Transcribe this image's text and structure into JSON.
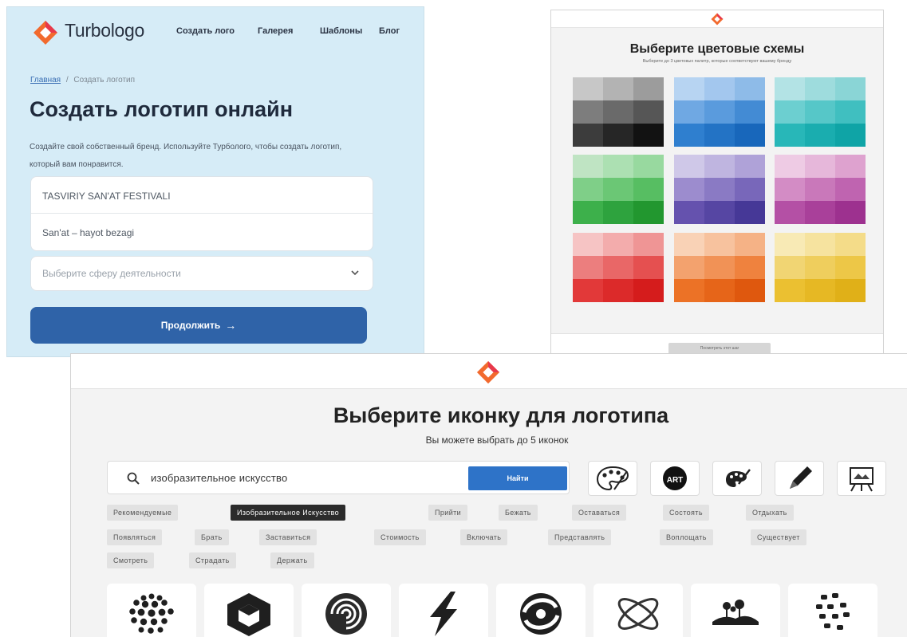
{
  "create_panel": {
    "brand": "Turbologo",
    "nav": [
      "Создать лого",
      "Галерея",
      "Шаблоны",
      "Блог"
    ],
    "breadcrumb": {
      "home": "Главная",
      "separator": "/",
      "current": "Создать логотип"
    },
    "heading": "Создать логотип онлайн",
    "description": "Создайте свой собственный бренд. Используйте Турболого, чтобы создать логотип, который вам понравится.",
    "company_name_value": "TASVIRIY SAN'AT FESTIVALI",
    "slogan_value": "San'at – hayot bezagi",
    "industry_placeholder": "Выберите сферу деятельности",
    "continue_label": "Продолжить",
    "continue_arrow": "→"
  },
  "colors_panel": {
    "title": "Выберите цветовые схемы",
    "subtitle": "Выберите до 3 цветовых палитр, которые соответствуют вашему бренду",
    "palettes": [
      {
        "name": "grey",
        "colors": [
          "#c7c7c7",
          "#b3b3b3",
          "#9c9c9c",
          "#7d7d7d",
          "#6a6a6a",
          "#565656",
          "#3c3c3c",
          "#262626",
          "#121212"
        ]
      },
      {
        "name": "blue",
        "colors": [
          "#b7d4f2",
          "#a3c7ee",
          "#8ebbe8",
          "#6fa8e3",
          "#5a9bdd",
          "#438bd4",
          "#2f7fcf",
          "#2373c5",
          "#1867bb"
        ]
      },
      {
        "name": "teal",
        "colors": [
          "#b3e3e5",
          "#9edcdd",
          "#8ad5d6",
          "#6ccfd0",
          "#56c7c8",
          "#40bfc0",
          "#28b7b8",
          "#1aadaf",
          "#0fa4a6"
        ]
      },
      {
        "name": "green",
        "colors": [
          "#bfe4c3",
          "#ace0b2",
          "#98d99f",
          "#7fcf88",
          "#6bc775",
          "#57be62",
          "#3db04b",
          "#2ea33e",
          "#22972f"
        ]
      },
      {
        "name": "purple",
        "colors": [
          "#cfc8e8",
          "#bfb5e0",
          "#afa2d8",
          "#9c8cce",
          "#8a7ac4",
          "#7867ba",
          "#6552ae",
          "#5646a3",
          "#463897"
        ]
      },
      {
        "name": "pink",
        "colors": [
          "#eecbe4",
          "#e6b7da",
          "#dea2cf",
          "#d38cc5",
          "#c978ba",
          "#bf64b0",
          "#b450a5",
          "#a9409a",
          "#9d318f"
        ]
      },
      {
        "name": "red",
        "colors": [
          "#f6c4c4",
          "#f3acac",
          "#ef9595",
          "#ec7e7e",
          "#e96767",
          "#e55050",
          "#e23939",
          "#dc2a2a",
          "#d51c1c"
        ]
      },
      {
        "name": "orange",
        "colors": [
          "#f9d2b6",
          "#f7c29e",
          "#f5b286",
          "#f3a26e",
          "#f19256",
          "#ef823e",
          "#ec7226",
          "#e66519",
          "#df580e"
        ]
      },
      {
        "name": "yellow",
        "colors": [
          "#f8eab5",
          "#f6e39f",
          "#f4dc89",
          "#f1d573",
          "#efce5d",
          "#edc747",
          "#ebc031",
          "#e6b824",
          "#e0b018"
        ]
      }
    ],
    "next_button": "Посмотреть этот шаг"
  },
  "icons_panel": {
    "title": "Выберите иконку для логотипа",
    "subtitle": "Вы можете выбрать до 5 иконок",
    "search_value": "изобразительное искусство",
    "search_button": "Найти",
    "suggested_icons": [
      "palette-icon",
      "art-badge-icon",
      "palette-brush-icon",
      "pencil-icon",
      "easel-icon"
    ],
    "art_badge_text": "ART",
    "tags_row1": [
      "Рекомендуемые",
      "Изобразительное Искусство",
      "Прийти",
      "Бежать",
      "Оставаться",
      "Состоять",
      "Отдыхать"
    ],
    "tags_row2": [
      "Появляться",
      "Брать",
      "Заставиться",
      "Стоимость",
      "Включать",
      "Представлять",
      "Воплощать",
      "Существует"
    ],
    "tags_row3": [
      "Смотреть",
      "Страдать",
      "Держать"
    ],
    "active_tag": "Изобразительное Искусство",
    "result_icons": [
      "dotted-sphere-icon",
      "cube-icon",
      "spiral-icon",
      "lightning-icon",
      "swirl-icon",
      "atom-icon",
      "hills-icon",
      "dots-grid-icon"
    ]
  },
  "colors": {
    "brand_orange": "#f26a2e",
    "brand_red": "#e8384b",
    "primary_blue": "#2f63a8",
    "search_blue": "#2e73c8",
    "form_bg": "#d6ecf7"
  }
}
